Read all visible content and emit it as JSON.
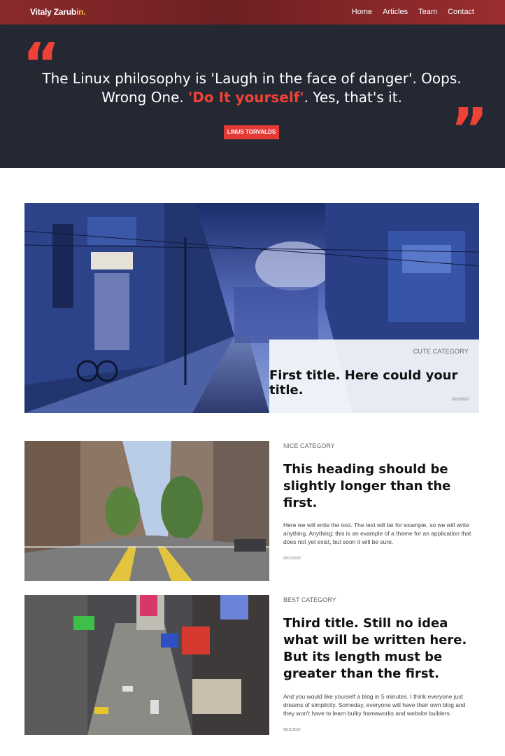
{
  "nav": {
    "brand_main": "Vitaly Zarub",
    "brand_accent": "in.",
    "items": [
      "Home",
      "Articles",
      "Team",
      "Contact"
    ]
  },
  "hero": {
    "quote_part1": "The Linux philosophy is 'Laugh in the face of danger'. Oops. Wrong One.",
    "quote_highlight": "'Do It yourself'",
    "quote_part2": ". Yes, that's it.",
    "author": "LINUS TORVALDS",
    "quote_open_glyph": "“",
    "quote_close_glyph": "”"
  },
  "featured": {
    "category": "CUTE CATEGORY",
    "title": "First title. Here could your title.",
    "date": "10/22/2020"
  },
  "posts": [
    {
      "category": "NICE CATEGORY",
      "title": "This heading should be slightly longer than the first.",
      "excerpt": "Here we will write the text. The text will be for example, so we will write anything. Anything: this is an example of a theme for an application that does not yet exist, but soon it will be sure.",
      "date": "09/21/2020"
    },
    {
      "category": "BEST CATEGORY",
      "title": "Third title. Still no idea what will be written here. But its length must be greater than the first.",
      "excerpt": "And you would like yourself a blog in 5 minutes. I think everyone just dreams of simplicity. Someday, everyone will have their own blog and they won't have to learn bulky frameworks and website builders.",
      "date": "08/11/2020"
    }
  ],
  "colors": {
    "nav_bg": "#7a2427",
    "hero_bg": "#232833",
    "accent": "#ef4136",
    "brand_accent": "#f5c33b"
  }
}
